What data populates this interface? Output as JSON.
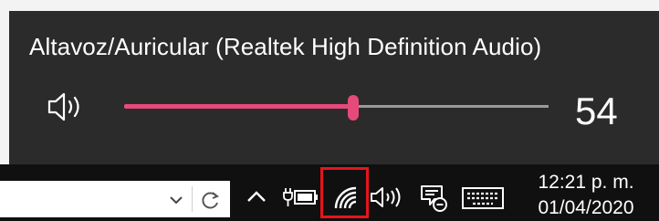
{
  "volume_flyout": {
    "device_name": "Altavoz/Auricular (Realtek High Definition Audio)",
    "volume_value": "54",
    "volume_level": 54,
    "accent_color": "#e64a7a",
    "speaker_icon": "speaker-icon"
  },
  "taskbar": {
    "address_bar": {
      "value": "",
      "dropdown_icon": "chevron-down-icon",
      "refresh_icon": "refresh-icon"
    },
    "tray_icons": [
      "chevron-up-icon",
      "battery-plug-icon",
      "network-icon",
      "speaker-icon",
      "notification-icon",
      "keyboard-icon"
    ],
    "highlight_color": "#e8141b",
    "clock": {
      "time": "12:21 p. m.",
      "date": "01/04/2020"
    }
  }
}
